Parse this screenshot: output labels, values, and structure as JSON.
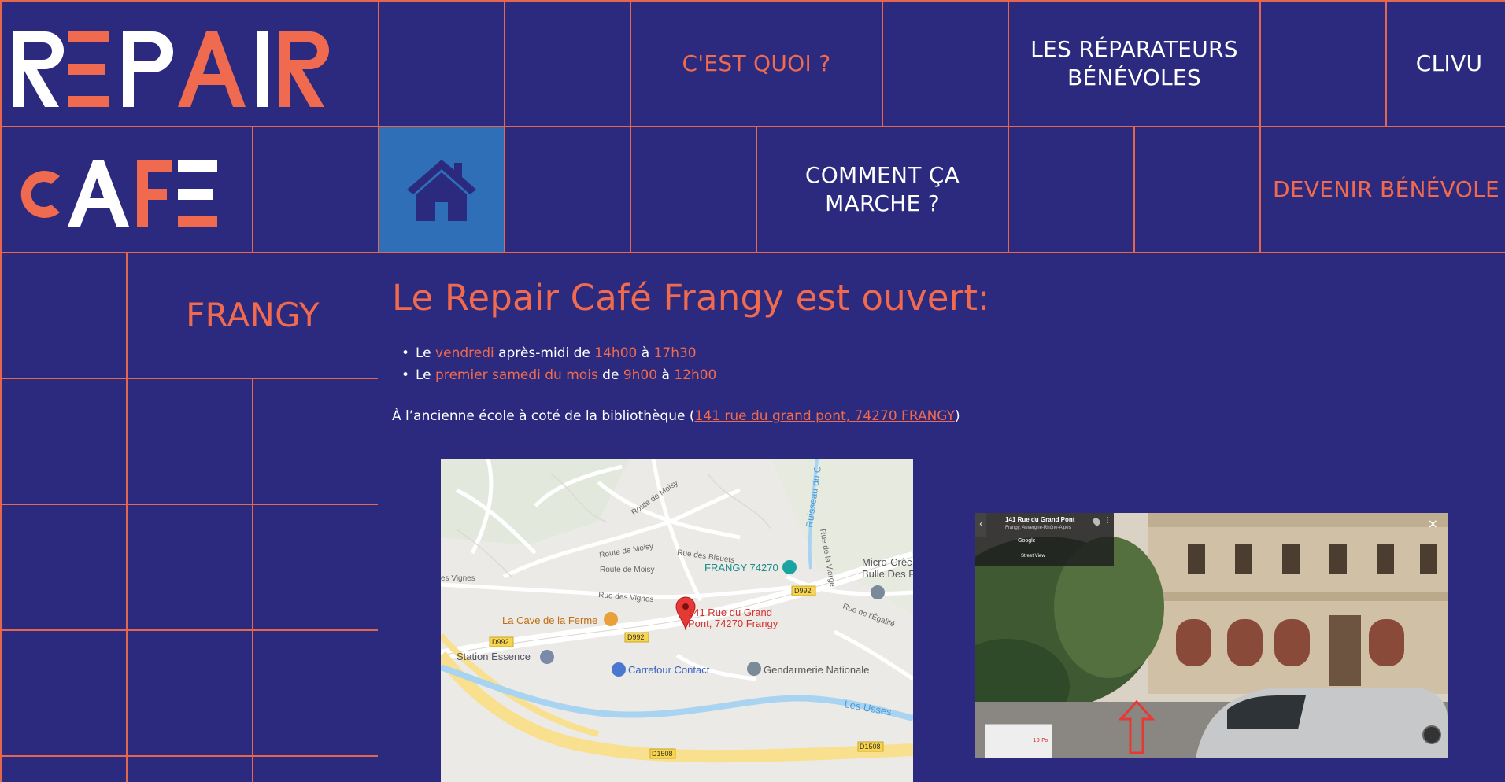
{
  "logo": {
    "line1": "REPAIR",
    "line2": "CAFE"
  },
  "site_name": "FRANGY",
  "nav": {
    "cest_quoi": "C'EST QUOI ?",
    "reparateurs_line1": "LES RÉPARATEURS",
    "reparateurs_line2": "BÉNÉVOLES",
    "clivu": "CLIVU",
    "comment_line1": "COMMENT ÇA",
    "comment_line2": "MARCHE ?",
    "devenir": "DEVENIR BÉNÉVOLE"
  },
  "main": {
    "title": "Le Repair Café Frangy est ouvert:",
    "schedule": [
      {
        "p1": "Le ",
        "day": "vendredi",
        "p2": " après-midi de ",
        "start": "14h00",
        "p3": " à ",
        "end": "17h30"
      },
      {
        "p1": "Le ",
        "day": "premier samedi du mois",
        "p2": " de ",
        "start": "9h00",
        "p3": " à ",
        "end": "12h00"
      }
    ],
    "address_prefix": "À l’ancienne école à coté de la bibliothèque (",
    "address_link": "141 rue du grand pont, 74270 FRANGY",
    "address_suffix": ")"
  },
  "map": {
    "pin_label_1": "141 Rue du Grand",
    "pin_label_2": "Pont, 74270 Frangy",
    "places": {
      "frangy": "FRANGY 74270",
      "cave": "La Cave de la Ferme",
      "station": "Station Essence",
      "carrefour": "Carrefour Contact",
      "gendarmerie": "Gendarmerie Nationale",
      "micro1": "Micro-Crèc",
      "micro2": "Bulle Des P"
    },
    "roads": {
      "moisy1": "Route de Moisy",
      "moisy2": "Route de Moisy",
      "moisy3": "Route de Moisy",
      "bleuets": "Rue des Bleuets",
      "vignes": "Rue des Vignes",
      "vignes2": "es Vignes",
      "ruisseau": "Ruisseau du C",
      "vierge": "Rue de la Vierge",
      "egalite": "Rue de l'Égalité",
      "usses": "Les Usses",
      "d992a": "D992",
      "d992b": "D992",
      "d992c": "D992",
      "d1508a": "D1508",
      "d1508b": "D1508"
    }
  },
  "streetview": {
    "title": "141 Rue du Grand Pont",
    "subtitle": "Frangy, Auvergne-Rhône-Alpes",
    "google": "Google",
    "mode": "Street View",
    "mini_label": "19 Po",
    "close": "×"
  },
  "colors": {
    "bg": "#2b2a7e",
    "accent": "#ef6a4e",
    "grid": "#e4674d",
    "home": "#2f6fb8"
  }
}
